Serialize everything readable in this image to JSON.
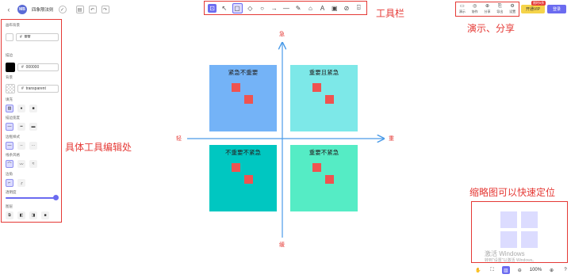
{
  "header": {
    "logo_text": "MB",
    "file_name": "四象限法则",
    "back_icon": "chevron-left-icon",
    "cloud_icon": "cloud-check-icon",
    "save_icon": "save-icon",
    "undo_icon": "undo-icon",
    "redo_icon": "redo-icon"
  },
  "toolbar": {
    "label": "工具栏",
    "tools": [
      {
        "name": "lock-tool",
        "glyph": "⊡"
      },
      {
        "name": "select-tool",
        "glyph": "↖"
      },
      {
        "name": "rectangle-tool",
        "glyph": "▢"
      },
      {
        "name": "diamond-tool",
        "glyph": "◇"
      },
      {
        "name": "ellipse-tool",
        "glyph": "○"
      },
      {
        "name": "arrow-tool",
        "glyph": "→"
      },
      {
        "name": "line-tool",
        "glyph": "—"
      },
      {
        "name": "pencil-tool",
        "glyph": "✎"
      },
      {
        "name": "eraser-tool",
        "glyph": "⌂"
      },
      {
        "name": "text-tool",
        "glyph": "A"
      },
      {
        "name": "image-tool",
        "glyph": "▣"
      },
      {
        "name": "laser-tool",
        "glyph": "⊘"
      },
      {
        "name": "library-tool",
        "glyph": "⌹"
      }
    ]
  },
  "right_actions": {
    "annotation": "演示、分享",
    "buttons": [
      {
        "name": "present-button",
        "glyph": "▭",
        "label": "演示"
      },
      {
        "name": "collab-button",
        "glyph": "◎",
        "label": "协作"
      },
      {
        "name": "share-button",
        "glyph": "⊕",
        "label": "分享"
      },
      {
        "name": "export-button",
        "glyph": "⎘",
        "label": "导出"
      },
      {
        "name": "settings-button",
        "glyph": "⚙",
        "label": "设置"
      }
    ],
    "vip_badge": "限时5折",
    "vip_label": "开通VIP",
    "login_label": "登录"
  },
  "left_panel": {
    "annotation": "具体工具编辑处",
    "canvas_bg_label": "画布背景",
    "canvas_bg_value": "ffffff",
    "stroke_label": "描边",
    "stroke_value": "000000",
    "stroke_color": "#000000",
    "bg_label": "背景",
    "bg_value": "transparent",
    "fill_label": "填充",
    "stroke_width_label": "描边宽度",
    "stroke_style_label": "边框样式",
    "sloppiness_label": "线条风格",
    "edges_label": "边角",
    "opacity_label": "透明度",
    "opacity": 1.0,
    "layers_label": "图层",
    "hash": "#"
  },
  "canvas": {
    "axis_color": "#4a9be8",
    "axis_top": "急",
    "axis_bottom": "缓",
    "axis_left": "轻",
    "axis_right": "重",
    "quadrants": [
      {
        "label": "紧急不重要",
        "color": "#74b3f7"
      },
      {
        "label": "重要且紧急",
        "color": "#7de8e8"
      },
      {
        "label": "不重要不紧急",
        "color": "#00c7c1"
      },
      {
        "label": "重要不紧急",
        "color": "#55ecc5"
      }
    ],
    "square_color": "#ef5350"
  },
  "minimap": {
    "annotation": "缩略图可以快速定位",
    "watermark_1": "激活 Windows",
    "watermark_2": "转到\"设置\"以激活 Windows。"
  },
  "zoom": {
    "value": "100%",
    "icons": [
      "hand-icon",
      "fullscreen-icon",
      "minimap-icon",
      "zoom-out-icon",
      "zoom-in-icon",
      "help-icon"
    ]
  }
}
